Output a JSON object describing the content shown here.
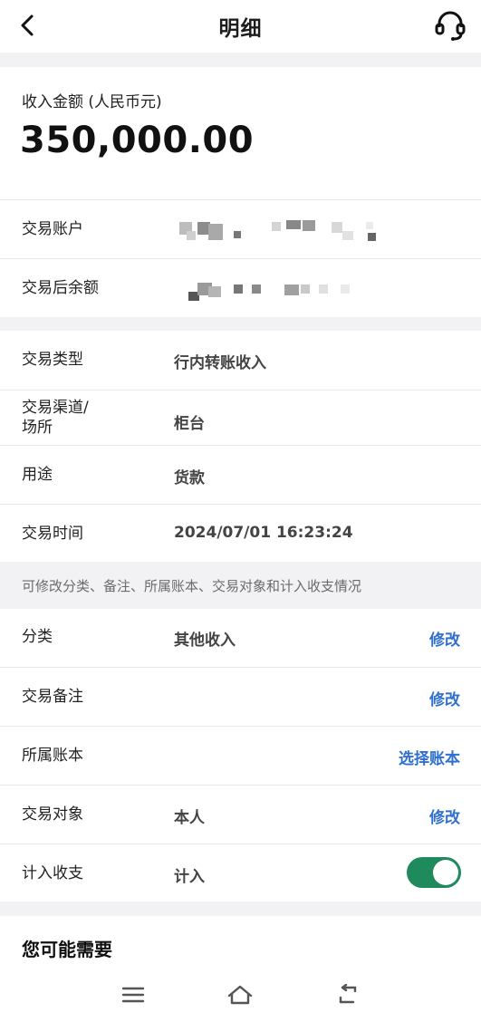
{
  "header": {
    "title": "明细"
  },
  "amount": {
    "label": "收入金额 (人民币元)",
    "value": "350,000.00"
  },
  "account_rows": [
    {
      "label": "交易账户"
    },
    {
      "label": "交易后余额"
    }
  ],
  "detail_rows": [
    {
      "label": "交易类型",
      "value": "行内转账收入"
    },
    {
      "label_line1": "交易渠道/",
      "label_line2": "场所",
      "value": "柜台"
    },
    {
      "label": "用途",
      "value": "货款"
    },
    {
      "label": "交易时间",
      "value": "2024/07/01 16:23:24"
    }
  ],
  "edit_note": "可修改分类、备注、所属账本、交易对象和计入收支情况",
  "edit_rows": [
    {
      "label": "分类",
      "value": "其他收入",
      "action": "修改"
    },
    {
      "label": "交易备注",
      "action": "修改"
    },
    {
      "label": "所属账本",
      "action": "选择账本"
    },
    {
      "label": "交易对象",
      "value": "本人",
      "action": "修改"
    },
    {
      "label": "计入收支",
      "value": "计入",
      "toggle_on": true
    }
  ],
  "recommend_title": "您可能需要",
  "colors": {
    "accent_blue": "#2f6fd0",
    "toggle_green": "#1f8a5c",
    "section_gap": "#f2f2f4"
  },
  "icons": {
    "back": "chevron-left-icon",
    "support": "headset-icon",
    "nav_menu": "menu-icon",
    "nav_home": "home-icon",
    "nav_back": "return-icon"
  }
}
